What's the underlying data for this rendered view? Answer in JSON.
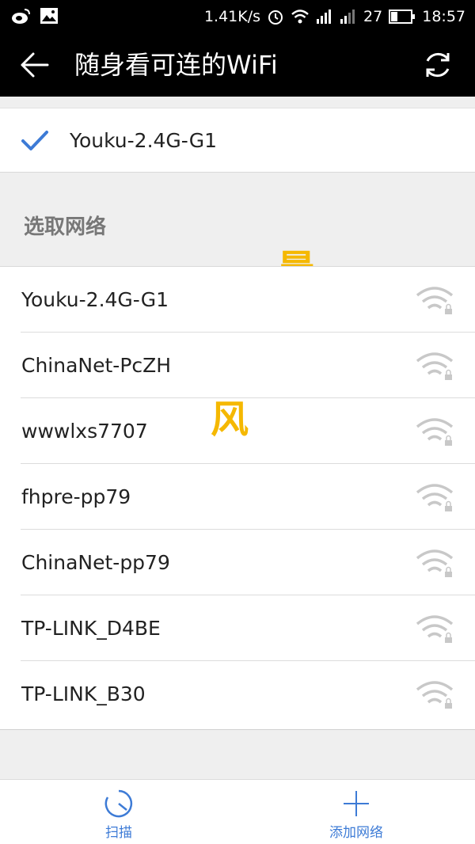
{
  "status_bar": {
    "speed": "1.41K/s",
    "battery": "27",
    "time": "18:57"
  },
  "app_bar": {
    "title": "随身看可连的WiFi"
  },
  "connected": {
    "ssid": "Youku-2.4G-G1"
  },
  "section": {
    "title": "选取网络"
  },
  "networks": [
    {
      "ssid": "Youku-2.4G-G1"
    },
    {
      "ssid": "ChinaNet-PcZH"
    },
    {
      "ssid": "wwwlxs7707"
    },
    {
      "ssid": "fhpre-pp79"
    },
    {
      "ssid": "ChinaNet-pp79"
    },
    {
      "ssid": "TP-LINK_D4BE"
    },
    {
      "ssid": "TP-LINK_B30"
    }
  ],
  "watermark": {
    "char1": "晨",
    "char2": "风"
  },
  "bottom_bar": {
    "scan_label": "扫描",
    "add_label": "添加网络"
  },
  "colors": {
    "accent": "#3d7bd6",
    "watermark": "#f5b800"
  }
}
